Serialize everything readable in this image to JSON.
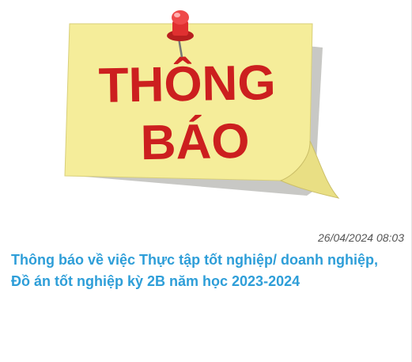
{
  "image": {
    "line1": "THÔNG",
    "line2": "BÁO",
    "icon": "push-pin-icon",
    "colors": {
      "note": "#f5ed9a",
      "note_shadow": "#9a9a95",
      "text": "#cc1f1f",
      "pin": "#e03030"
    }
  },
  "post": {
    "date": "26/04/2024 08:03",
    "title_line1": "Thông báo về việc Thực tập tốt nghiệp/ doanh nghiệp,",
    "title_line2": "Đồ án tốt nghiệp kỳ 2B năm học 2023-2024",
    "title_color": "#2e9ed8"
  }
}
